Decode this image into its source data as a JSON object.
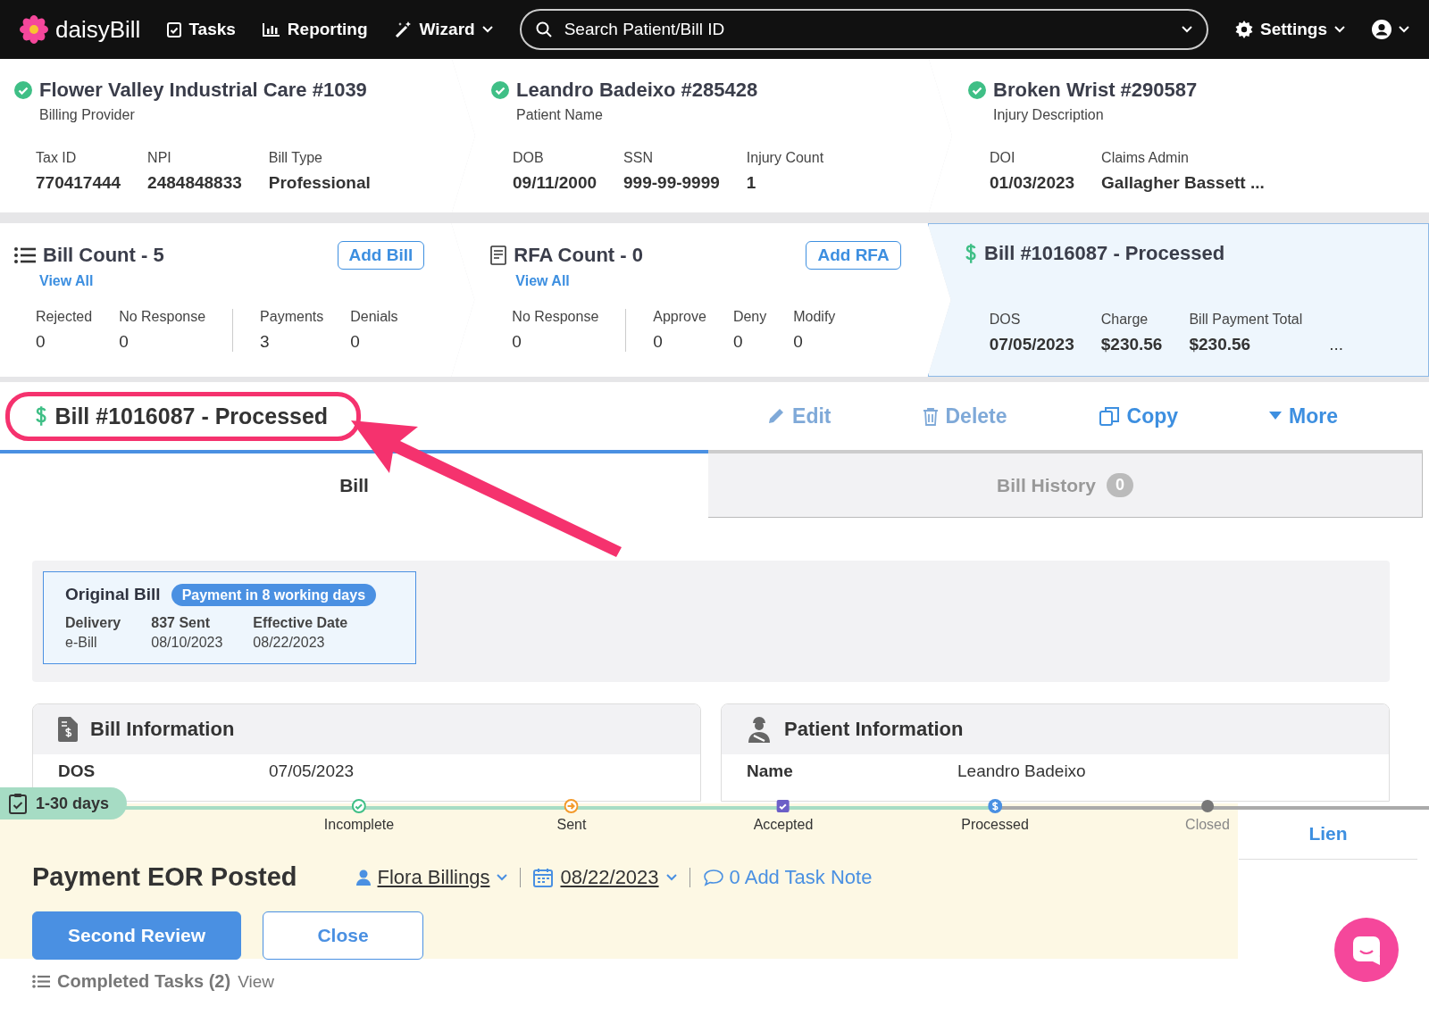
{
  "nav": {
    "logo": "daisyBill",
    "items": [
      {
        "kind": "tasks",
        "label": "Tasks"
      },
      {
        "kind": "reporting",
        "label": "Reporting"
      },
      {
        "kind": "wizard",
        "label": "Wizard",
        "dropdown": true
      }
    ],
    "search": {
      "placeholder": "Search Patient/Bill ID"
    },
    "settings": "Settings"
  },
  "summary_cards": [
    {
      "title": "Flower Valley Industrial Care #1039",
      "subtitle": "Billing Provider",
      "verified": true,
      "fields": [
        {
          "label": "Tax ID",
          "value": "770417444"
        },
        {
          "label": "NPI",
          "value": "2484848833"
        },
        {
          "label": "Bill Type",
          "value": "Professional"
        }
      ]
    },
    {
      "title": "Leandro Badeixo #285428",
      "subtitle": "Patient Name",
      "verified": true,
      "fields": [
        {
          "label": "DOB",
          "value": "09/11/2000"
        },
        {
          "label": "SSN",
          "value": "999-99-9999"
        },
        {
          "label": "Injury Count",
          "value": "1"
        }
      ]
    },
    {
      "title": "Broken Wrist #290587",
      "subtitle": "Injury Description",
      "verified": true,
      "fields": [
        {
          "label": "DOI",
          "value": "01/03/2023"
        },
        {
          "label": "Claims Admin",
          "value": "Gallagher Bassett ..."
        }
      ]
    }
  ],
  "count_cards": [
    {
      "kind": "list",
      "title": "Bill Count - 5",
      "link": "View All",
      "button": "Add Bill",
      "groups": [
        [
          {
            "label": "Rejected",
            "value": "0"
          },
          {
            "label": "No Response",
            "value": "0"
          }
        ],
        [
          {
            "label": "Payments",
            "value": "3"
          },
          {
            "label": "Denials",
            "value": "0"
          }
        ]
      ]
    },
    {
      "kind": "form",
      "title": "RFA Count - 0",
      "link": "View All",
      "button": "Add RFA",
      "groups": [
        [
          {
            "label": "No Response",
            "value": "0"
          }
        ],
        [
          {
            "label": "Approve",
            "value": "0"
          },
          {
            "label": "Deny",
            "value": "0"
          },
          {
            "label": "Modify",
            "value": "0"
          }
        ]
      ]
    }
  ],
  "current_bill": {
    "title": "Bill #1016087 - Processed",
    "selected": true,
    "fields": [
      {
        "label": "DOS",
        "value": "07/05/2023"
      },
      {
        "label": "Charge",
        "value": "$230.56"
      },
      {
        "label": "Bill Payment Total",
        "value": "$230.56"
      }
    ],
    "more": "..."
  },
  "bill_header": {
    "title": "Bill #1016087 - Processed",
    "actions": [
      {
        "kind": "edit",
        "label": "Edit",
        "disabled": true
      },
      {
        "kind": "delete",
        "label": "Delete",
        "disabled": true
      },
      {
        "kind": "copy",
        "label": "Copy",
        "disabled": false
      },
      {
        "kind": "more",
        "label": "More",
        "disabled": false
      }
    ]
  },
  "tabs": [
    {
      "label": "Bill",
      "selected": true
    },
    {
      "label": "Bill History",
      "selected": false,
      "count": "0"
    }
  ],
  "original_bill": {
    "title": "Original Bill",
    "badge": "Payment in 8 working days",
    "fields": [
      {
        "label": "Delivery",
        "value": "e-Bill"
      },
      {
        "label": "837 Sent",
        "value": "08/10/2023"
      },
      {
        "label": "Effective Date",
        "value": "08/22/2023"
      }
    ]
  },
  "panels": [
    {
      "kind": "bill",
      "title": "Bill Information",
      "rows": [
        {
          "label": "DOS",
          "value": "07/05/2023"
        }
      ]
    },
    {
      "kind": "patient",
      "title": "Patient Information",
      "rows": [
        {
          "label": "Name",
          "value": "Leandro Badeixo"
        }
      ]
    }
  ],
  "lien_tab": "Lien",
  "task": {
    "duration": "1-30 days",
    "steps": [
      {
        "kind": "check",
        "label": "Incomplete",
        "completed": true
      },
      {
        "kind": "arrow",
        "label": "Sent",
        "completed": true
      },
      {
        "kind": "box",
        "label": "Accepted",
        "completed": true
      },
      {
        "kind": "dollar",
        "label": "Processed",
        "completed": true
      },
      {
        "kind": "dot",
        "label": "Closed",
        "completed": false
      }
    ],
    "title": "Payment EOR Posted",
    "assignee": "Flora Billings",
    "date": "08/22/2023",
    "note": "0 Add Task Note",
    "buttons": [
      {
        "kind": "primary",
        "label": "Second Review"
      },
      {
        "kind": "secondary",
        "label": "Close"
      }
    ]
  },
  "completed_tasks": {
    "label": "Completed Tasks (2)",
    "link": "View"
  }
}
